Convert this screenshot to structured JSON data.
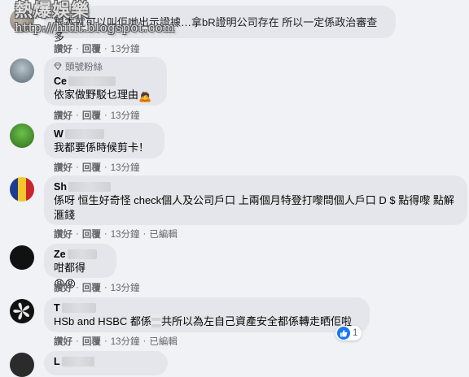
{
  "watermark": {
    "title": "熱爆娛樂",
    "url": "http://hitlt.blogspot.com"
  },
  "actions": {
    "like": "讚好",
    "reply": "回覆",
    "sep": "·"
  },
  "comments": [
    {
      "name": "",
      "text": "根本就可以叫佢哋出示證據…拿bR證明公司存在 所以一定係政治審查多",
      "time": "13分鐘",
      "avatar_icon": "profile-photo"
    },
    {
      "badge": "頭號粉絲",
      "badge_icon": "diamond-icon",
      "name": "Ce",
      "text": "依家做野駁乜理由",
      "emoji": "🙇",
      "time": "13分鐘",
      "avatar_icon": "profile-photo"
    },
    {
      "name": "W",
      "text": "我都要係時候剪卡！",
      "time": "13分鐘",
      "avatar_icon": "green-character-photo"
    },
    {
      "name": "Sh",
      "text": "係呀 恒生好奇怪 check個人及公司戶口 上兩個月特登打嚟問個人戶口 D $ 點得嚟 點解滙錢",
      "time": "13分鐘",
      "edited": "已編輯",
      "avatar_icon": "flag-photo"
    },
    {
      "name": "Ze",
      "text": "咁都得",
      "emoji": "😡😡",
      "time": "13分鐘",
      "avatar_icon": "black-photo"
    },
    {
      "name": "T",
      "text_a": "HSb and HSBC 都係",
      "text_b": "共所以為左自己資產安全都係轉走晒佢啦",
      "time": "13分鐘",
      "edited": "已編輯",
      "reaction_count": "1",
      "avatar_icon": "fan-logo-photo"
    },
    {
      "name": "L",
      "avatar_icon": "profile-photo"
    }
  ],
  "colors": {
    "bubble": "#e4e6eb",
    "page": "#f0f2f5",
    "like": "#1877f2",
    "meta": "#65676b"
  }
}
